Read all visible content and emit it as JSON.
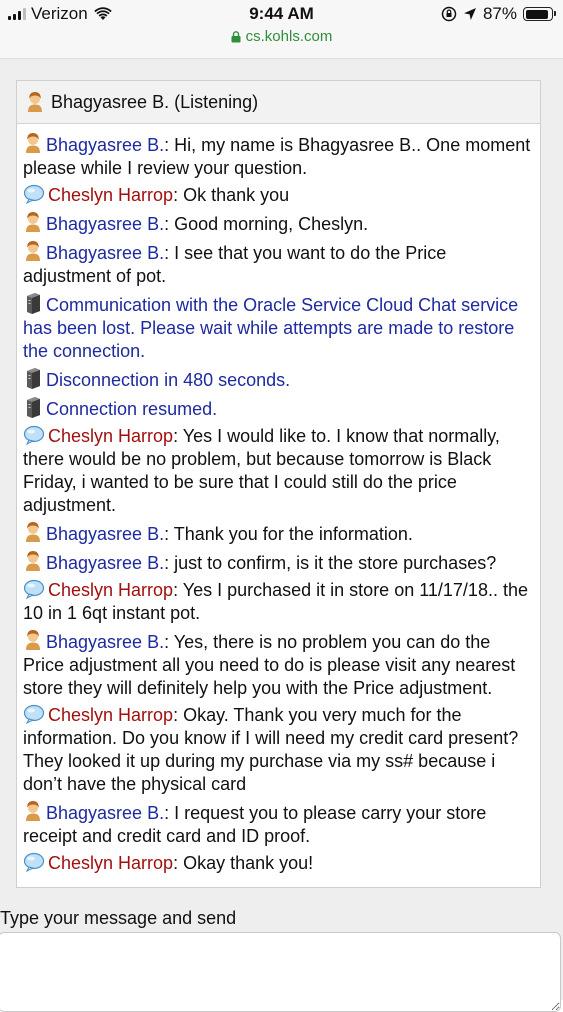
{
  "status_bar": {
    "carrier": "Verizon",
    "time": "9:44 AM",
    "battery": "87%",
    "url": "cs.kohls.com"
  },
  "chat": {
    "header_title": "Bhagyasree B. (Listening)",
    "messages": [
      {
        "type": "agent",
        "sender": "Bhagyasree B.",
        "text": ": Hi, my name is Bhagyasree B.. One moment please while I review your question."
      },
      {
        "type": "customer",
        "sender": "Cheslyn Harrop",
        "text": ": Ok thank you"
      },
      {
        "type": "agent",
        "sender": "Bhagyasree B.",
        "text": ": Good morning, Cheslyn."
      },
      {
        "type": "agent",
        "sender": "Bhagyasree B.",
        "text": ": I see that you want to do the Price adjustment of pot."
      },
      {
        "type": "system",
        "text": "Communication with the Oracle Service Cloud Chat service has been lost. Please wait while attempts are made to restore the connection."
      },
      {
        "type": "system",
        "text": "Disconnection in 480 seconds."
      },
      {
        "type": "system",
        "text": "Connection resumed."
      },
      {
        "type": "customer",
        "sender": "Cheslyn Harrop",
        "text": ": Yes I would like to. I know that normally, there would be no problem, but because tomorrow is Black Friday, i wanted to be sure that I could still do the price adjustment."
      },
      {
        "type": "agent",
        "sender": "Bhagyasree B.",
        "text": ": Thank you for the information."
      },
      {
        "type": "agent",
        "sender": "Bhagyasree B.",
        "text": ": just to confirm, is it the store purchases?"
      },
      {
        "type": "customer",
        "sender": "Cheslyn Harrop",
        "text": ": Yes I purchased it in store on 11/17/18.. the 10 in 1 6qt instant pot."
      },
      {
        "type": "agent",
        "sender": "Bhagyasree B.",
        "text": ": Yes, there is no problem you can do the Price adjustment all you need to do is please visit any nearest store they will definitely help you with the Price adjustment."
      },
      {
        "type": "customer",
        "sender": "Cheslyn Harrop",
        "text": ": Okay. Thank you very much for the information. Do you know if I will need my credit card present? They looked it up during my purchase via my ss# because i don’t have the physical card"
      },
      {
        "type": "agent",
        "sender": "Bhagyasree B.",
        "text": ": I request you to please carry your store receipt and credit card and ID proof."
      },
      {
        "type": "customer",
        "sender": "Cheslyn Harrop",
        "text": ": Okay thank you!"
      }
    ]
  },
  "compose": {
    "label": "Type your message and send",
    "value": ""
  },
  "icons": {
    "agent": "agent-avatar-icon",
    "customer": "customer-chat-bubble-icon",
    "system": "server-icon"
  },
  "colors": {
    "agent_name": "#1d2aa0",
    "customer_name": "#a10f0f",
    "url_green": "#2e8f3a"
  }
}
